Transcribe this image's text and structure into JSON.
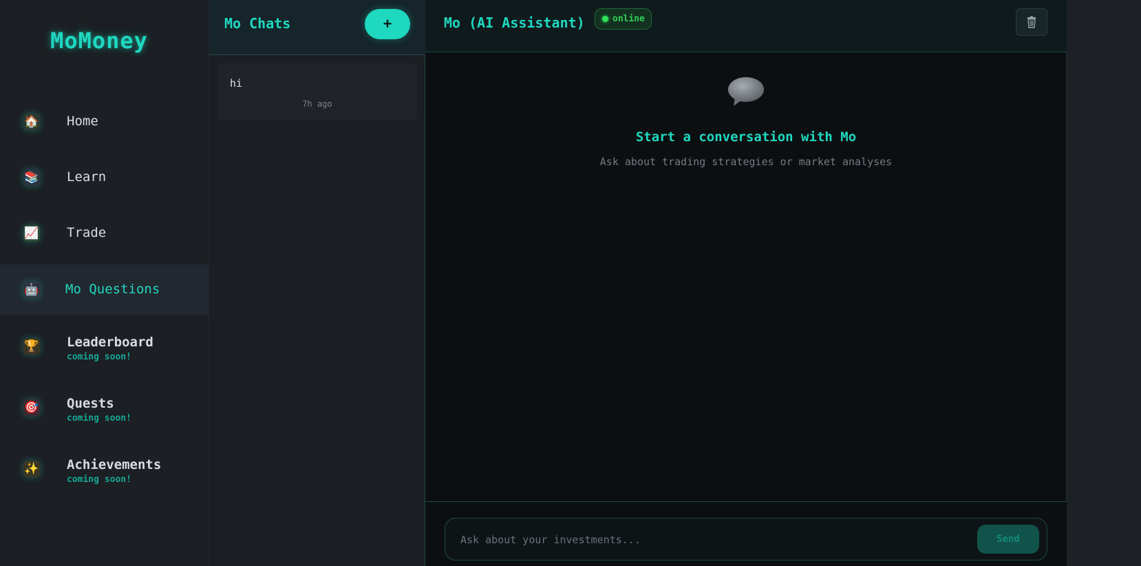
{
  "brand": "MoMoney",
  "nav": {
    "items": [
      {
        "label": "Home",
        "icon": "house-icon",
        "glyph": "🏠",
        "sub": ""
      },
      {
        "label": "Learn",
        "icon": "books-icon",
        "glyph": "📚",
        "sub": ""
      },
      {
        "label": "Trade",
        "icon": "chart-increasing-icon",
        "glyph": "📈",
        "sub": ""
      },
      {
        "label": "Mo Questions",
        "icon": "robot-icon",
        "glyph": "🤖",
        "sub": "",
        "active": true
      },
      {
        "label": "Leaderboard",
        "icon": "trophy-icon",
        "glyph": "🏆",
        "sub": "coming soon!"
      },
      {
        "label": "Quests",
        "icon": "target-icon",
        "glyph": "🎯",
        "sub": "coming soon!"
      },
      {
        "label": "Achievements",
        "icon": "sparkles-icon",
        "glyph": "✨",
        "sub": "coming soon!"
      }
    ]
  },
  "chatlist": {
    "title": "Mo Chats",
    "new_label": "+",
    "chats": [
      {
        "title": "hi",
        "time": "7h ago"
      }
    ]
  },
  "main": {
    "title": "Mo (AI Assistant)",
    "status": "online",
    "empty_title": "Start a conversation with Mo",
    "empty_subtitle": "Ask about trading strategies or market analyses",
    "input_placeholder": "Ask about your investments...",
    "input_value": "",
    "send_label": "Send"
  },
  "colors": {
    "accent": "#1fd8c0",
    "status_green": "#34d058",
    "sidebar_bg": "#1c1f23",
    "main_bg": "#0c0f11"
  }
}
